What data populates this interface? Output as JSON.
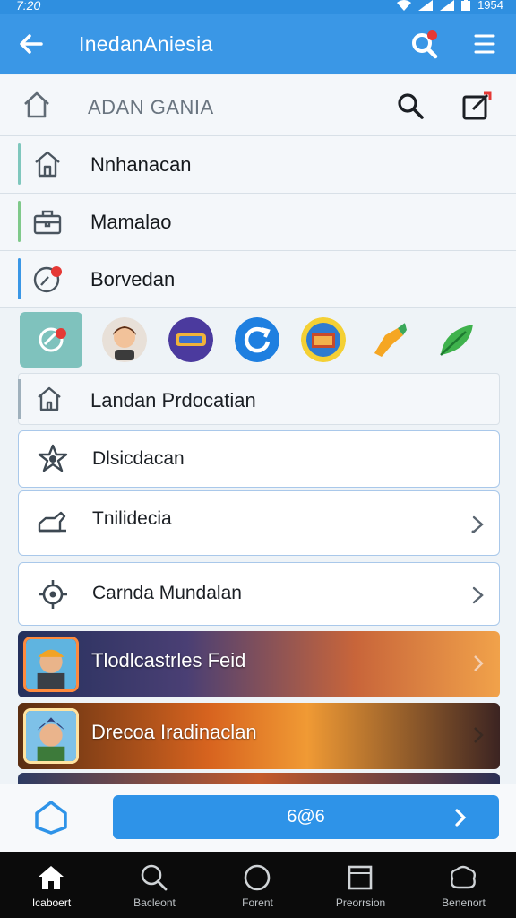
{
  "status_bar": {
    "time": "7:20",
    "battery": "1954"
  },
  "app_bar": {
    "title": "InedanAniesia"
  },
  "subheader": {
    "title": "ADAN GANIA"
  },
  "nav_items": [
    {
      "label": "Nnhanacan",
      "accent": "#7fc7bd"
    },
    {
      "label": "Mamalao",
      "accent": "#7fc98a"
    },
    {
      "label": "Borvedan",
      "accent": "#3a97e6"
    }
  ],
  "app_strip": {
    "icons": [
      "tag-app-icon",
      "avatar-app-icon",
      "game-app-icon",
      "refresh-app-icon",
      "badge-app-icon",
      "hand-app-icon",
      "leaf-app-icon"
    ]
  },
  "section_row": {
    "label": "Landan Prdocatian"
  },
  "cards": [
    {
      "label": "Dlsicdacan",
      "icon": "star-icon",
      "chevron": false
    },
    {
      "label": "Tnilidecia",
      "icon": "car-icon",
      "chevron": true
    },
    {
      "label": "Carnda Mundalan",
      "icon": "target-icon",
      "chevron": true
    }
  ],
  "banners": [
    {
      "label": "Tlodlcastrles Feid"
    },
    {
      "label": "Drecoa Iradinaclan"
    }
  ],
  "action_bar": {
    "button_label": "6@6"
  },
  "bottom_nav": [
    {
      "label": "Icaboert",
      "active": true
    },
    {
      "label": "Bacleont",
      "active": false
    },
    {
      "label": "Forent",
      "active": false
    },
    {
      "label": "Preorrsion",
      "active": false
    },
    {
      "label": "Benenort",
      "active": false
    }
  ],
  "colors": {
    "primary": "#3a97e6",
    "notification": "#e53935",
    "nav_background": "#0b0b0b"
  }
}
